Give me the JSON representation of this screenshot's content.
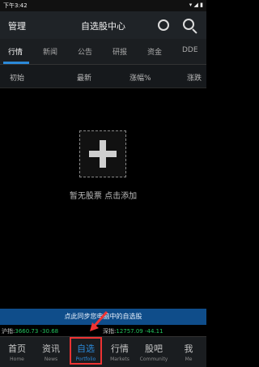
{
  "status": {
    "time": "下午3:42",
    "right": "▾ ◢ ▮"
  },
  "header": {
    "manage": "管理",
    "title": "自选股中心"
  },
  "tabs": [
    "行情",
    "新闻",
    "公告",
    "研报",
    "资金",
    "DDE"
  ],
  "columns": [
    "初始",
    "最新",
    "涨幅%",
    "涨跌"
  ],
  "empty": {
    "text": "暂无股票  点击添加"
  },
  "sync": {
    "label": "点此同步您电脑中的自选股"
  },
  "ticker": {
    "sh_label": "沪指:",
    "sh_value": "3660.73 -30.68",
    "sz_label": "深指:",
    "sz_value": "12757.09 -44.11"
  },
  "nav": [
    {
      "cn": "首页",
      "en": "Home"
    },
    {
      "cn": "资讯",
      "en": "News"
    },
    {
      "cn": "自选",
      "en": "Portfolio"
    },
    {
      "cn": "行情",
      "en": "Markets"
    },
    {
      "cn": "股吧",
      "en": "Community"
    },
    {
      "cn": "我",
      "en": "Me"
    }
  ],
  "colors": {
    "accent": "#2b89d8",
    "positive": "#22c55e",
    "highlight": "#e33333"
  }
}
